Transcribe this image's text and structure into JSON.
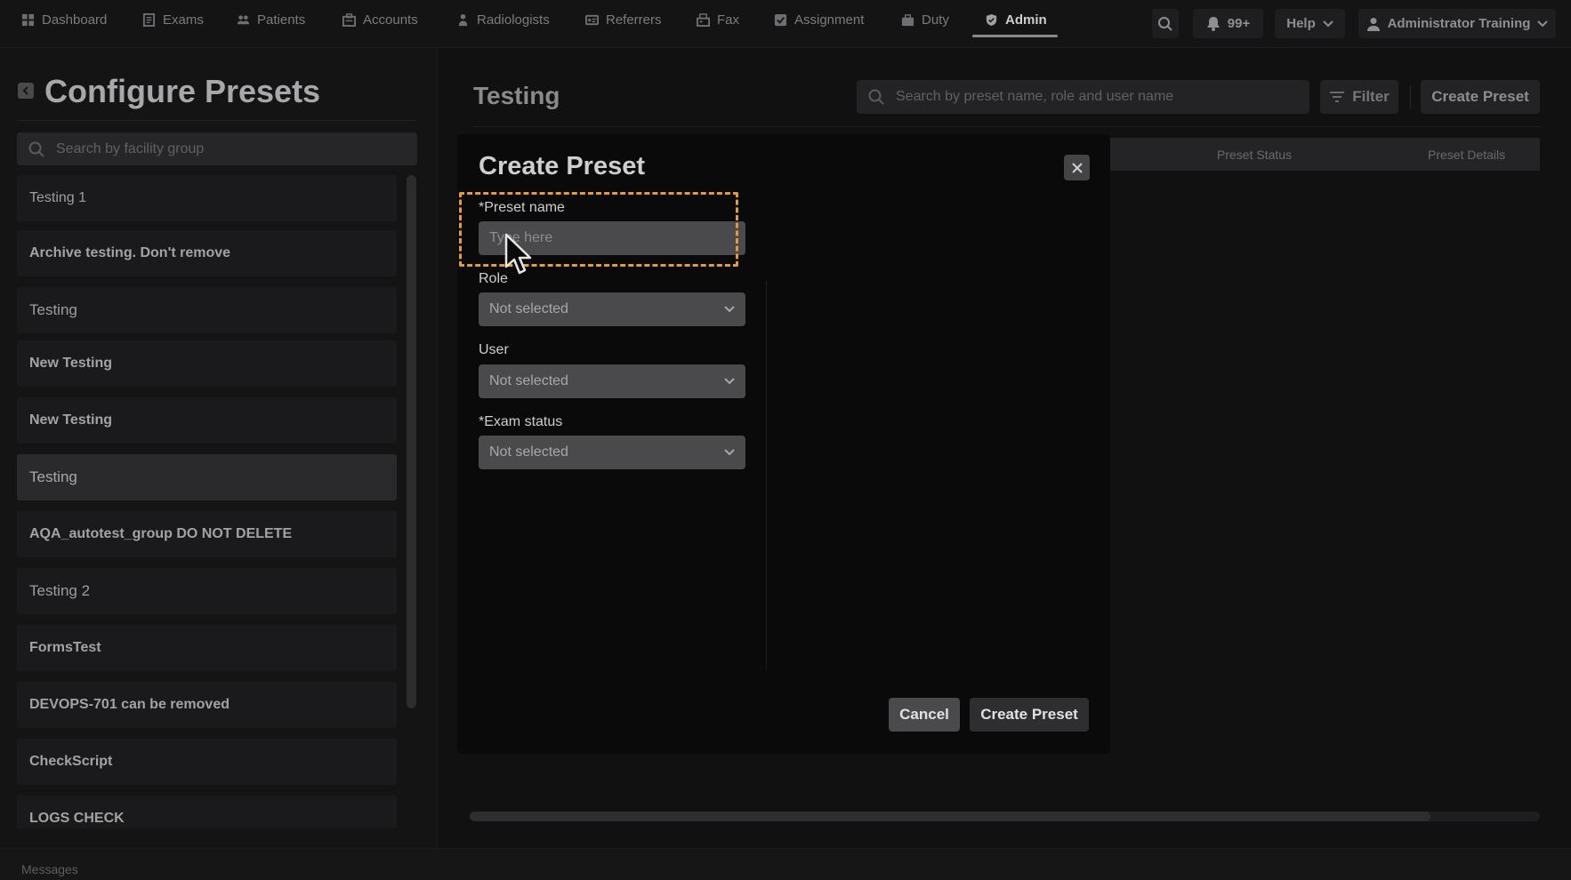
{
  "nav": {
    "items": [
      {
        "label": "Dashboard",
        "icon": "dashboard-icon"
      },
      {
        "label": "Exams",
        "icon": "exams-icon"
      },
      {
        "label": "Patients",
        "icon": "patients-icon"
      },
      {
        "label": "Accounts",
        "icon": "accounts-icon"
      },
      {
        "label": "Radiologists",
        "icon": "radiologist-icon"
      },
      {
        "label": "Referrers",
        "icon": "referrers-icon"
      },
      {
        "label": "Fax",
        "icon": "fax-icon"
      },
      {
        "label": "Assignment",
        "icon": "assignment-icon"
      },
      {
        "label": "Duty",
        "icon": "duty-icon"
      },
      {
        "label": "Admin",
        "icon": "shield-icon",
        "active": true
      }
    ],
    "notifications_count": "99+",
    "help_label": "Help",
    "user_name": "Administrator Training"
  },
  "sidebar": {
    "title": "Configure Presets",
    "search_placeholder": "Search by facility group",
    "groups": [
      {
        "label": "Testing 1"
      },
      {
        "label": "Archive testing. Don't remove"
      },
      {
        "label": "Testing"
      },
      {
        "label": "New Testing"
      },
      {
        "label": "New Testing"
      },
      {
        "label": "Testing",
        "selected": true
      },
      {
        "label": "AQA_autotest_group DO NOT DELETE"
      },
      {
        "label": "Testing 2"
      },
      {
        "label": "FormsTest"
      },
      {
        "label": "DEVOPS-701 can be removed"
      },
      {
        "label": "CheckScript"
      },
      {
        "label": "LOGS CHECK"
      }
    ]
  },
  "main": {
    "title": "Testing",
    "search_placeholder": "Search by preset name, role and user name",
    "filter_label": "Filter",
    "create_label": "Create Preset",
    "columns": [
      "Preset Status",
      "Preset Details"
    ]
  },
  "modal": {
    "title": "Create Preset",
    "preset_name_label": "Preset name",
    "preset_name_placeholder": "Type here",
    "preset_name_value": "",
    "role_label": "Role",
    "role_value": "Not selected",
    "user_label": "User",
    "user_value": "Not selected",
    "exam_status_label": "Exam status",
    "exam_status_value": "Not selected",
    "required_marker": "*",
    "cancel_label": "Cancel",
    "create_label": "Create Preset"
  },
  "footer": {
    "label": "Messages"
  },
  "colors": {
    "highlight": "#e29a3c",
    "background": "#111112",
    "modal": "#0a0a0a"
  }
}
